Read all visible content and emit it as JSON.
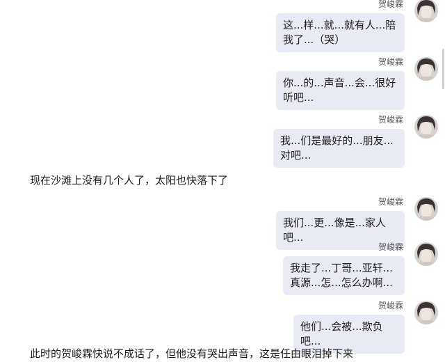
{
  "sender_name": "贺峻霖",
  "messages": [
    {
      "sender": "贺峻霖",
      "text": "这...样...就...就有人...陪我了...（哭）"
    },
    {
      "sender": "贺峻霖",
      "text": "你...的...声音...会...很好听吧..."
    },
    {
      "sender": "贺峻霖",
      "text": "我...们是最好的...朋友...对吧..."
    },
    {
      "sender": "贺峻霖",
      "text": "我们...更...像是...家人吧..."
    },
    {
      "sender": "贺峻霖",
      "text": "我走了...丁哥...亚轩...真源...怎...怎么办啊..."
    },
    {
      "sender": "贺峻霖",
      "text": "他们...会被...欺负吧..."
    }
  ],
  "narration": [
    "现在沙滩上没有几个人了，太阳也快落下了",
    "此时的贺峻霖快说不成话了，但他没有哭出声音，这是任由眼泪掉下来"
  ],
  "avatar_icon": "user-avatar-icon",
  "colors": {
    "bubble": "#e8ebf3",
    "background": "#ffffff"
  }
}
